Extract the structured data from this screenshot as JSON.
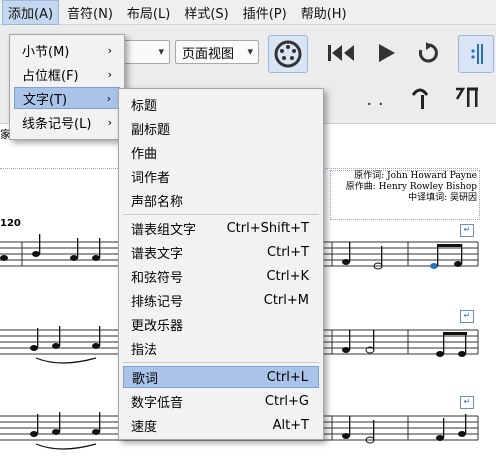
{
  "menubar": {
    "items": [
      {
        "label": "添加(A)",
        "active": true
      },
      {
        "label": "音符(N)"
      },
      {
        "label": "布局(L)"
      },
      {
        "label": "样式(S)"
      },
      {
        "label": "插件(P)"
      },
      {
        "label": "帮助(H)"
      }
    ]
  },
  "toolbar": {
    "view_mode": "页面视图"
  },
  "add_menu": {
    "items": [
      "小节(M)",
      "占位框(F)",
      "文字(T)",
      "线条记号(L)"
    ],
    "active_index": 2
  },
  "text_submenu": {
    "items": [
      {
        "label": "标题",
        "shortcut": ""
      },
      {
        "label": "副标题",
        "shortcut": ""
      },
      {
        "label": "作曲",
        "shortcut": ""
      },
      {
        "label": "词作者",
        "shortcut": ""
      },
      {
        "label": "声部名称",
        "shortcut": ""
      },
      {
        "label": "谱表组文字",
        "shortcut": "Ctrl+Shift+T"
      },
      {
        "label": "谱表文字",
        "shortcut": "Ctrl+T"
      },
      {
        "label": "和弦符号",
        "shortcut": "Ctrl+K"
      },
      {
        "label": "排练记号",
        "shortcut": "Ctrl+M"
      },
      {
        "label": "更改乐器",
        "shortcut": ""
      },
      {
        "label": "指法",
        "shortcut": ""
      },
      {
        "label": "歌词",
        "shortcut": "Ctrl+L"
      },
      {
        "label": "数字低音",
        "shortcut": "Ctrl+G"
      },
      {
        "label": "速度",
        "shortcut": "Alt+T"
      }
    ],
    "highlighted_index": 11
  },
  "score": {
    "credits": [
      "原作词: John Howard Payne",
      "原作曲: Henry Rowley Bishop",
      "中译填词: 吴研因"
    ],
    "measure_number": "120",
    "left_label_fragment": "家"
  },
  "colors": {
    "highlight": "#a9c4e8",
    "menubar_active": "#c3d7ef"
  }
}
